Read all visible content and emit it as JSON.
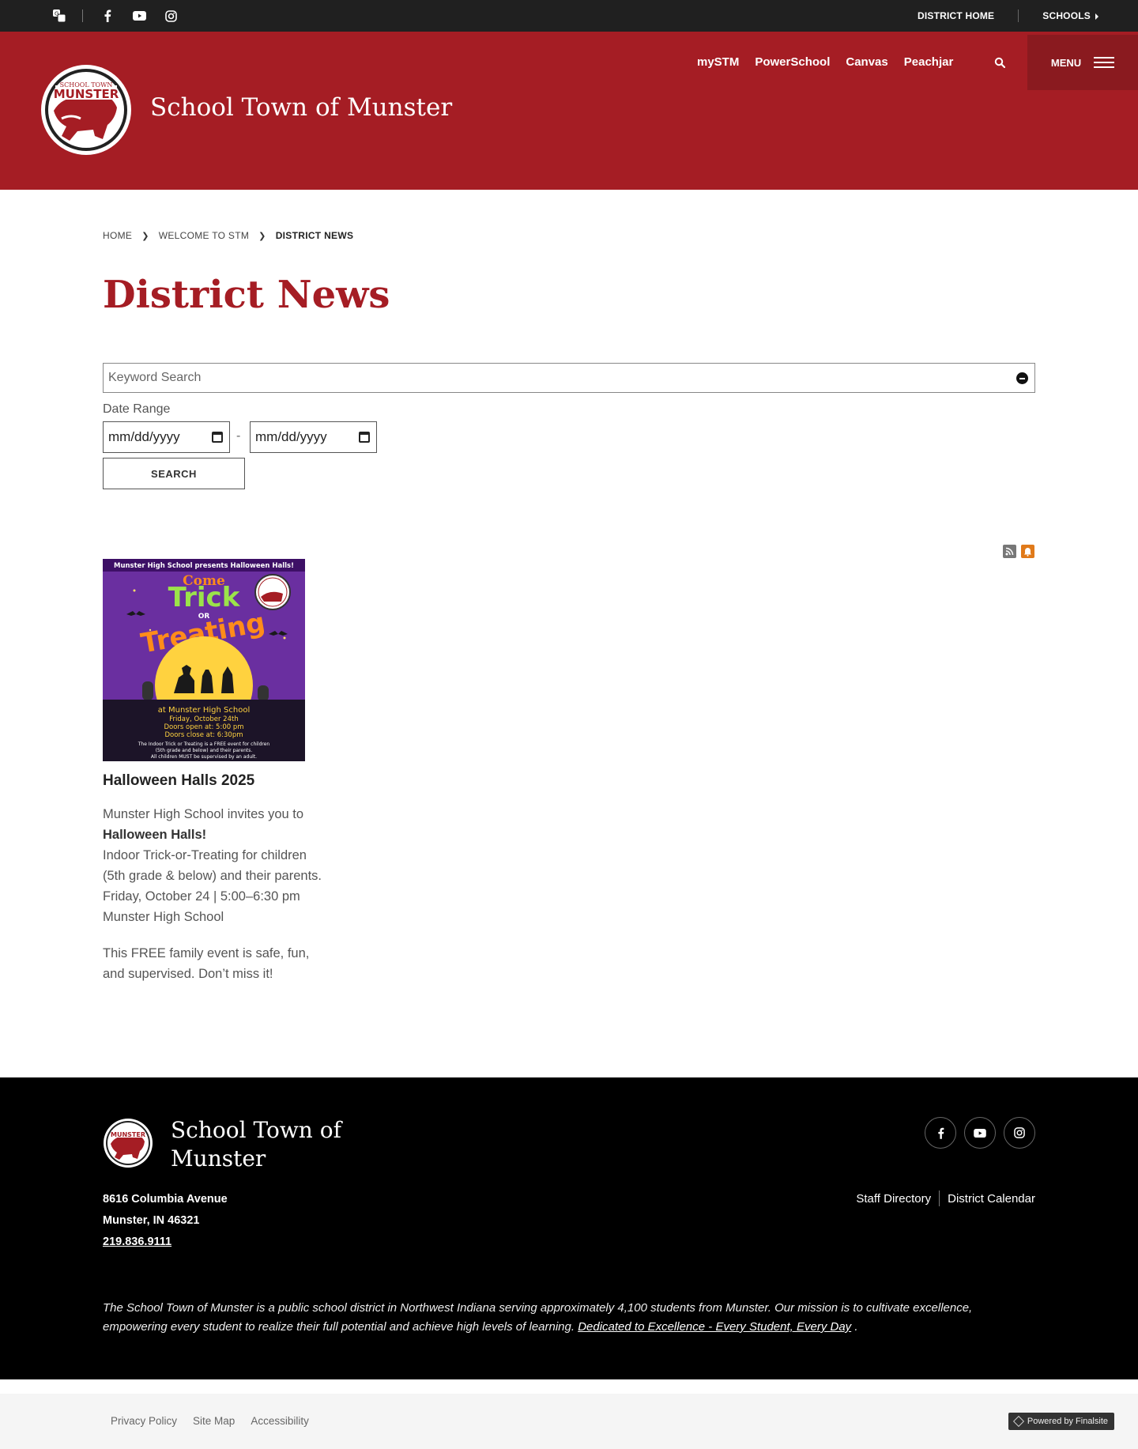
{
  "topbar": {
    "district_home": "DISTRICT HOME",
    "schools": "SCHOOLS"
  },
  "header": {
    "site_title": "School Town of Munster",
    "logo_text_top": "SCHOOL TOWN",
    "logo_text_main": "MUNSTER",
    "quicklinks": [
      "mySTM",
      "PowerSchool",
      "Canvas",
      "Peachjar"
    ],
    "menu_label": "MENU"
  },
  "breadcrumb": [
    "HOME",
    "WELCOME TO STM",
    "DISTRICT NEWS"
  ],
  "page_title": "District News",
  "search": {
    "keyword_placeholder": "Keyword Search",
    "date_range_label": "Date Range",
    "date_from": "mm/dd/yyyy",
    "date_to": "mm/dd/yyyy",
    "date_separator": "-",
    "submit_label": "SEARCH"
  },
  "news": {
    "title": "Halloween Halls 2025",
    "intro": "Munster High School invites you to ",
    "intro_bold": "Halloween Halls!",
    "line1": "Indoor Trick-or-Treating for children (5th grade & below) and their parents.",
    "line2": "Friday, October 24 | 5:00–6:30 pm",
    "line3": "Munster High School",
    "closing": "This FREE family event is safe, fun, and supervised. Don’t miss it!",
    "flyer": {
      "banner": "Munster High School presents Halloween Halls!",
      "come": "Come",
      "trick": "Trick",
      "or": "OR",
      "treating": "Treating",
      "at": "at Munster High School",
      "date": "Friday, October 24th",
      "open": "Doors open at: 5:00 pm",
      "close": "Doors close at: 6:30pm",
      "fine1": "The Indoor Trick or Treating is a FREE event for children",
      "fine2": "(5th grade and below) and their parents.",
      "fine3": "All children MUST be supervised by an adult."
    }
  },
  "footer": {
    "title": "School Town of Munster",
    "address1": "8616 Columbia Avenue",
    "address2": "Munster, IN  46321",
    "phone": "219.836.9111",
    "links": [
      "Staff Directory",
      "District Calendar"
    ],
    "mission": "The School Town of Munster is a public school district in Northwest Indiana serving approximately 4,100 students from Munster. Our mission is to cultivate excellence, empowering every student to realize their full potential and achieve high levels of learning. ",
    "mission_link": "Dedicated to Excellence - Every Student, Every Day",
    "mission_end": " ."
  },
  "bottom": {
    "links": [
      "Privacy Policy",
      "Site Map",
      "Accessibility"
    ],
    "powered": "Powered by Finalsite"
  },
  "colors": {
    "brand_red": "#a51d24",
    "topbar": "#202020",
    "footer": "#000000",
    "flyer_purple": "#6a2fa0"
  }
}
